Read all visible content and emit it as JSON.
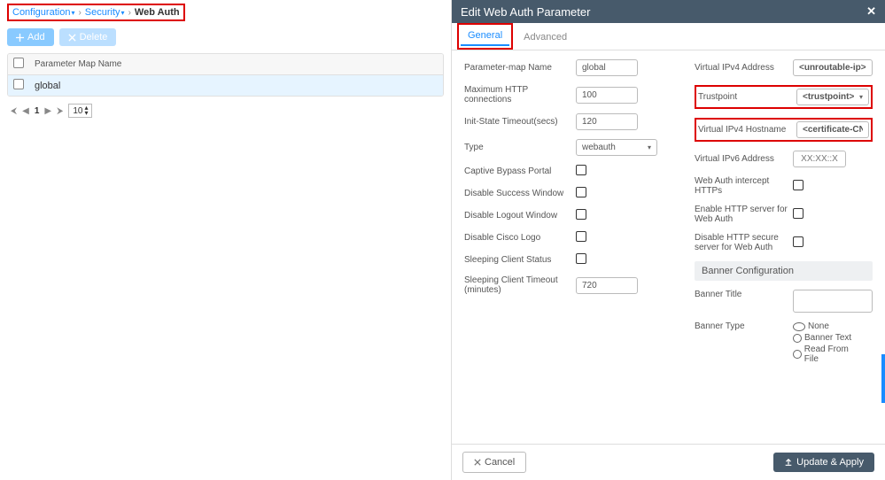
{
  "breadcrumb": {
    "c1": "Configuration",
    "c2": "Security",
    "c3": "Web Auth"
  },
  "toolbar": {
    "add": "Add",
    "delete": "Delete"
  },
  "table": {
    "col1": "Parameter Map Name",
    "rows": [
      {
        "name": "global"
      }
    ]
  },
  "pager": {
    "page": "1",
    "size": "10"
  },
  "panel": {
    "title": "Edit Web Auth Parameter"
  },
  "tabs": {
    "general": "General",
    "advanced": "Advanced"
  },
  "form": {
    "pmap_label": "Parameter-map Name",
    "pmap_value": "global",
    "maxhttp_label": "Maximum HTTP connections",
    "maxhttp_value": "100",
    "initstate_label": "Init-State Timeout(secs)",
    "initstate_value": "120",
    "type_label": "Type",
    "type_value": "webauth",
    "captive_label": "Captive Bypass Portal",
    "disable_success_label": "Disable Success Window",
    "disable_logout_label": "Disable Logout Window",
    "disable_cisco_label": "Disable Cisco Logo",
    "sleeping_status_label": "Sleeping Client Status",
    "sleeping_timeout_label": "Sleeping Client Timeout (minutes)",
    "sleeping_timeout_value": "720",
    "vipv4_label": "Virtual IPv4 Address",
    "vipv4_value": "<unroutable-ip>",
    "trustpoint_label": "Trustpoint",
    "trustpoint_value": "<trustpoint>",
    "vipv4host_label": "Virtual IPv4 Hostname",
    "vipv4host_value": "<certificate-CN>",
    "vipv6_label": "Virtual IPv6 Address",
    "vipv6_ph": "XX:XX::X",
    "intercept_label": "Web Auth intercept HTTPs",
    "enable_http_label": "Enable HTTP server for Web Auth",
    "disable_https_label": "Disable HTTP secure server for Web Auth",
    "banner_section": "Banner Configuration",
    "banner_title_label": "Banner Title",
    "banner_type_label": "Banner Type",
    "banner_none": "None",
    "banner_text": "Banner Text",
    "banner_file": "Read From File"
  },
  "footer": {
    "cancel": "Cancel",
    "apply": "Update & Apply"
  }
}
